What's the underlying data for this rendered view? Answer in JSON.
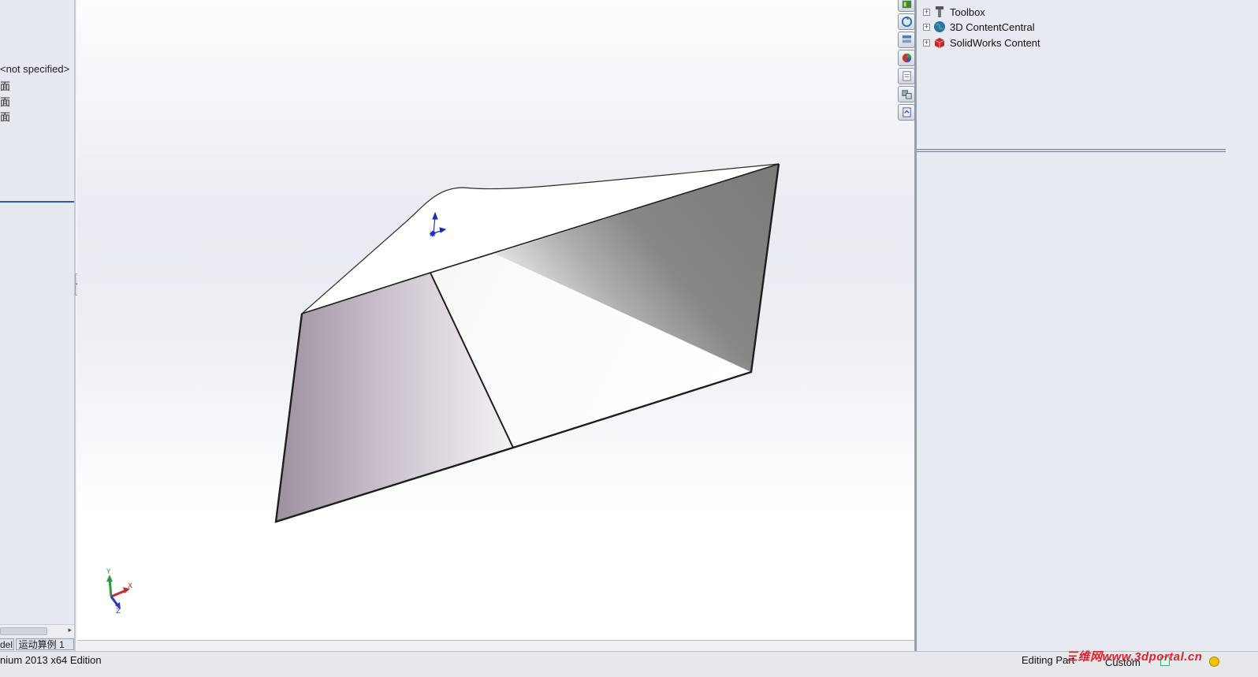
{
  "feature_tree": {
    "rows": [
      {
        "label": "<not specified>"
      },
      {
        "label": "面"
      },
      {
        "label": "面"
      },
      {
        "label": "面"
      }
    ],
    "tabs": [
      {
        "label": "del"
      },
      {
        "label": "运动算例 1"
      }
    ]
  },
  "design_library": {
    "items": [
      {
        "label": "Toolbox",
        "icon": "toolbox-icon"
      },
      {
        "label": "3D ContentCentral",
        "icon": "globe-icon"
      },
      {
        "label": "SolidWorks Content",
        "icon": "solidworks-box-icon"
      }
    ]
  },
  "task_pane_tabs": [
    {
      "icon": "resources-icon"
    },
    {
      "icon": "design-library-icon"
    },
    {
      "icon": "file-explorer-icon"
    },
    {
      "icon": "appearances-icon"
    },
    {
      "icon": "custom-properties-icon"
    },
    {
      "icon": "view-palette-icon"
    },
    {
      "icon": "document-recovery-icon"
    }
  ],
  "triad": {
    "x": "X",
    "y": "Y",
    "z": "Z"
  },
  "status_bar": {
    "product": "nium 2013 x64 Edition",
    "editing": "Editing Part",
    "units": "Custom"
  },
  "watermark": "三维网www.3dportal.cn",
  "colors": {
    "accent": "#2a5ea8",
    "model_dark_face": "#808080",
    "model_light_face": "#ffffff",
    "model_purple_face": "#a597a6",
    "watermark": "#e0202a"
  }
}
